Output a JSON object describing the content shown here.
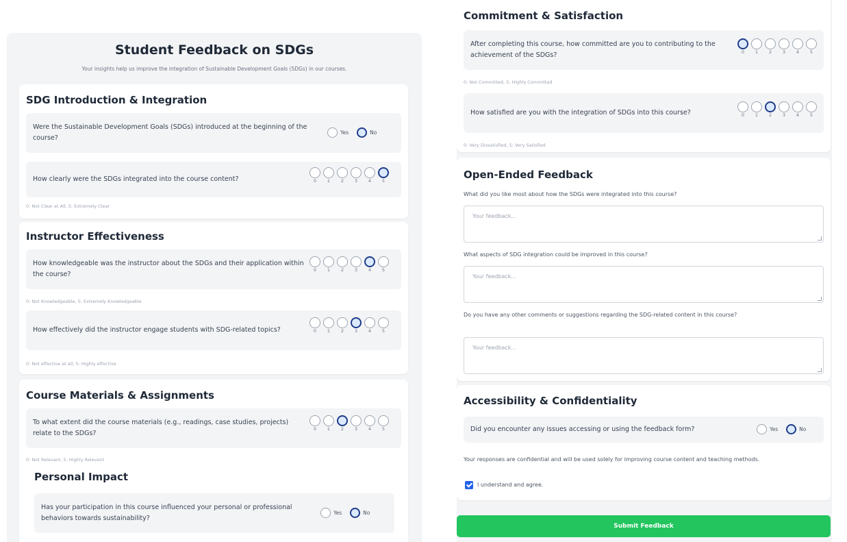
{
  "form": {
    "title": "Student Feedback on SDGs",
    "subtitle": "Your insights help us improve the integration of Sustainable Development Goals (SDGs) in our courses."
  },
  "rating_numbers": [
    "0",
    "1",
    "2",
    "3",
    "4",
    "5"
  ],
  "yes_label": "Yes",
  "no_label": "No",
  "sections": {
    "intro": {
      "title": "SDG Introduction & Integration",
      "q1": {
        "text": "Were the Sustainable Development Goals (SDGs) introduced at the beginning of the course?",
        "answer": "No"
      },
      "q2": {
        "text": "How clearly were the SDGs integrated into the course content?",
        "rating": 5,
        "note": "0: Not Clear at All, 5: Extremely Clear"
      }
    },
    "instructor": {
      "title": "Instructor Effectiveness",
      "q1": {
        "text": "How knowledgeable was the instructor about the SDGs and their application within the course?",
        "rating": 4,
        "note": "0: Not Knowledgeable, 5: Extremely Knowledgeable"
      },
      "q2": {
        "text": "How effectively did the instructor engage students with SDG-related topics?",
        "rating": 3,
        "note": "0: Not effective at all, 5: Highly effective"
      }
    },
    "materials": {
      "title": "Course Materials & Assignments",
      "q1": {
        "text": "To what extent did the course materials (e.g., readings, case studies, projects) relate to the SDGs?",
        "rating": 2,
        "note": "0: Not Relevant, 5: Highly Relevant"
      }
    },
    "impact": {
      "title": "Personal Impact",
      "q1": {
        "text": "Has your participation in this course influenced your personal or professional behaviors towards sustainability?",
        "answer": "No"
      }
    },
    "commitment": {
      "title": "Commitment & Satisfaction",
      "q1": {
        "text": "After completing this course, how committed are you to contributing to the achievement of the SDGs?",
        "rating": 0,
        "note": "0: Not Committed, 5: Highly Committed"
      },
      "q2": {
        "text": "How satisfied are you with the integration of SDGs into this course?",
        "rating": 2,
        "note": "0: Very Dissatisfied, 5: Very Satisfied"
      }
    },
    "open": {
      "title": "Open-Ended Feedback",
      "q1_label": "What did you like most about how the SDGs were integrated into this course?",
      "q2_label": "What aspects of SDG integration could be improved in this course?",
      "q3_label": "Do you have any other comments or suggestions regarding the SDG-related content in this course?",
      "placeholder": "Your feedback..."
    },
    "access": {
      "title": "Accessibility & Confidentiality",
      "q1": {
        "text": "Did you encounter any issues accessing or using the feedback form?",
        "answer": "No"
      },
      "confidential": "Your responses are confidential and will be used solely for improving course content and teaching methods.",
      "agree_label": "I understand and agree.",
      "agree_checked": true
    }
  },
  "submit_label": "Submit Feedback",
  "colors": {
    "accent": "#1e3a8a",
    "submit": "#22c55e",
    "checkbox": "#2563eb"
  }
}
